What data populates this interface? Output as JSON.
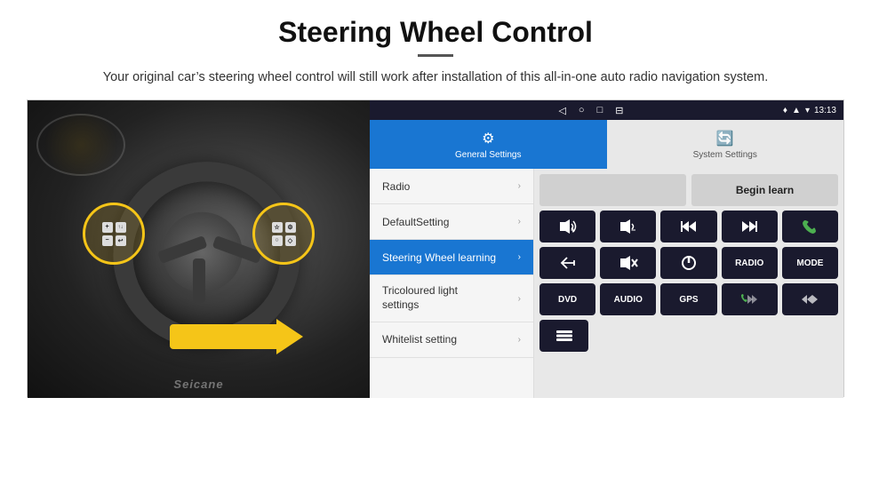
{
  "page": {
    "title": "Steering Wheel Control",
    "subtitle": "Your original car’s steering wheel control will still work after installation of this all-in-one auto radio navigation system."
  },
  "status_bar": {
    "nav_icons": [
      "◁",
      "○",
      "□",
      "⊟"
    ],
    "signal": "▼▲",
    "wifi": "▾",
    "time": "13:13"
  },
  "tabs": [
    {
      "label": "General Settings",
      "active": true
    },
    {
      "label": "System Settings",
      "active": false
    }
  ],
  "settings_items": [
    {
      "label": "Radio",
      "highlighted": false
    },
    {
      "label": "DefaultSetting",
      "highlighted": false
    },
    {
      "label": "Steering Wheel learning",
      "highlighted": true
    },
    {
      "label": "Tricoloured light settings",
      "highlighted": false
    },
    {
      "label": "Whitelist setting",
      "highlighted": false
    }
  ],
  "right_panel": {
    "begin_learn": "Begin learn",
    "row2": [
      "🔊+",
      "🔊−",
      "⏮",
      "⏭",
      "📞"
    ],
    "row3": [
      "↩",
      "🔇",
      "⏻",
      "RADIO",
      "MODE"
    ],
    "row4": [
      "DVD",
      "AUDIO",
      "GPS",
      "📞⏮",
      "⏮⏭"
    ],
    "row5": [
      "≡"
    ]
  },
  "ctrl_buttons": {
    "row2": [
      {
        "label": "◄+",
        "sym": "vol_up"
      },
      {
        "label": "◄−",
        "sym": "vol_down"
      },
      {
        "label": "⏮",
        "sym": "prev"
      },
      {
        "label": "⏭",
        "sym": "next"
      },
      {
        "label": "☎",
        "sym": "phone"
      }
    ],
    "row3": [
      {
        "label": "↩",
        "sym": "back"
      },
      {
        "label": "◄✕",
        "sym": "mute"
      },
      {
        "label": "⏻",
        "sym": "power"
      },
      {
        "label": "RADIO",
        "sym": "radio"
      },
      {
        "label": "MODE",
        "sym": "mode"
      }
    ],
    "row4": [
      {
        "label": "DVD",
        "sym": "dvd"
      },
      {
        "label": "AUDIO",
        "sym": "audio"
      },
      {
        "label": "GPS",
        "sym": "gps"
      },
      {
        "label": "☎⏮",
        "sym": "phone_prev"
      },
      {
        "label": "⏮⏭",
        "sym": "prev_next"
      }
    ],
    "row5": [
      {
        "label": "≡",
        "sym": "menu"
      }
    ]
  },
  "watermark": "Seicane"
}
